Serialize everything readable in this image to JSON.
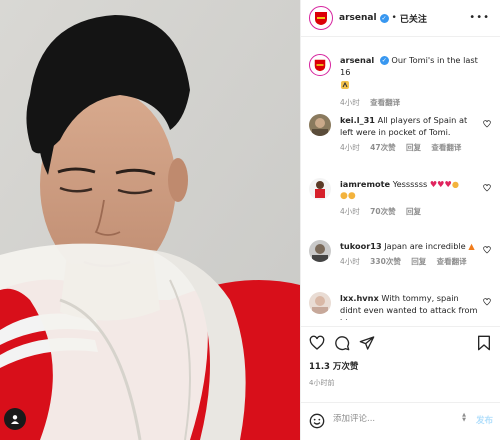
{
  "post": {
    "account": "arsenal",
    "follow_status": "已关注",
    "caption_user": "arsenal",
    "caption_text": "Our Tomi's in the last 16",
    "caption_time": "4小时",
    "translate_label": "查看翻译",
    "likes": "11.3 万次赞",
    "timestamp": "4小时前"
  },
  "comments": [
    {
      "user": "kei.l_31",
      "text": "All players of Spain at left were in pocket of Tomi.",
      "time": "4小时",
      "likes": "47次赞",
      "reply": "回复",
      "translate": "查看翻译"
    },
    {
      "user": "iamremote",
      "text": "Yessssss",
      "time": "4小时",
      "likes": "70次赞",
      "reply": "回复",
      "translate": ""
    },
    {
      "user": "tukoor13",
      "text": "Japan are incredible",
      "time": "4小时",
      "likes": "330次赞",
      "reply": "回复",
      "translate": "查看翻译"
    },
    {
      "user": "lxx.hvnx",
      "text": "With tommy, spain didnt even wanted to attack from his",
      "time": "",
      "likes": "",
      "reply": "",
      "translate": ""
    }
  ],
  "composer": {
    "placeholder": "添加评论...",
    "post_label": "发布"
  },
  "icons": {
    "like": "heart-icon",
    "comment": "comment-icon",
    "share": "send-icon",
    "save": "bookmark-icon",
    "emoji": "emoji-icon",
    "more": "more-icon"
  },
  "colors": {
    "verified": "#3897f0",
    "heart_red": "#e0245e",
    "arsenal_red": "#db0007",
    "post_button": "#b2dffc"
  }
}
